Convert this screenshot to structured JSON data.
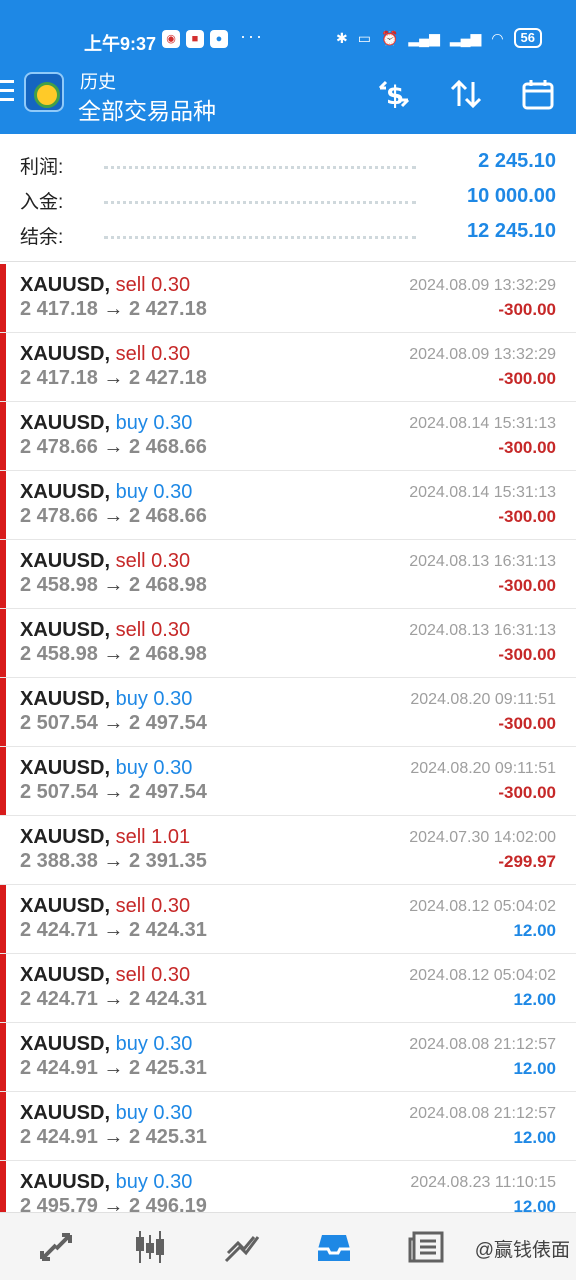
{
  "status_bar": {
    "time": "上午9:37",
    "dots": "···",
    "battery": "56",
    "icons": [
      "app-icon-1",
      "app-icon-2",
      "app-icon-3",
      "bluetooth-icon",
      "vibrate-icon",
      "alarm-icon",
      "signal-icon",
      "signal-icon",
      "wifi-icon"
    ]
  },
  "app_bar": {
    "title": "历史",
    "subtitle": "全部交易品种"
  },
  "summary": {
    "profit_label": "利润:",
    "profit_value": "2 245.10",
    "deposit_label": "入金:",
    "deposit_value": "10 000.00",
    "balance_label": "结余:",
    "balance_value": "12 245.10"
  },
  "deals": [
    {
      "symbol": "XAUUSD,",
      "side": "sell",
      "volume": "0.30",
      "open": "2 417.18",
      "arrow": "→",
      "close": "2 427.18",
      "time": "2024.08.09 13:32:29",
      "profit": "-300.00",
      "bar": true
    },
    {
      "symbol": "XAUUSD,",
      "side": "sell",
      "volume": "0.30",
      "open": "2 417.18",
      "arrow": "→",
      "close": "2 427.18",
      "time": "2024.08.09 13:32:29",
      "profit": "-300.00",
      "bar": true
    },
    {
      "symbol": "XAUUSD,",
      "side": "buy",
      "volume": "0.30",
      "open": "2 478.66",
      "arrow": "→",
      "close": "2 468.66",
      "time": "2024.08.14 15:31:13",
      "profit": "-300.00",
      "bar": true
    },
    {
      "symbol": "XAUUSD,",
      "side": "buy",
      "volume": "0.30",
      "open": "2 478.66",
      "arrow": "→",
      "close": "2 468.66",
      "time": "2024.08.14 15:31:13",
      "profit": "-300.00",
      "bar": true
    },
    {
      "symbol": "XAUUSD,",
      "side": "sell",
      "volume": "0.30",
      "open": "2 458.98",
      "arrow": "→",
      "close": "2 468.98",
      "time": "2024.08.13 16:31:13",
      "profit": "-300.00",
      "bar": true
    },
    {
      "symbol": "XAUUSD,",
      "side": "sell",
      "volume": "0.30",
      "open": "2 458.98",
      "arrow": "→",
      "close": "2 468.98",
      "time": "2024.08.13 16:31:13",
      "profit": "-300.00",
      "bar": true
    },
    {
      "symbol": "XAUUSD,",
      "side": "buy",
      "volume": "0.30",
      "open": "2 507.54",
      "arrow": "→",
      "close": "2 497.54",
      "time": "2024.08.20 09:11:51",
      "profit": "-300.00",
      "bar": true
    },
    {
      "symbol": "XAUUSD,",
      "side": "buy",
      "volume": "0.30",
      "open": "2 507.54",
      "arrow": "→",
      "close": "2 497.54",
      "time": "2024.08.20 09:11:51",
      "profit": "-300.00",
      "bar": true
    },
    {
      "symbol": "XAUUSD,",
      "side": "sell",
      "volume": "1.01",
      "open": "2 388.38",
      "arrow": "→",
      "close": "2 391.35",
      "time": "2024.07.30 14:02:00",
      "profit": "-299.97",
      "bar": false
    },
    {
      "symbol": "XAUUSD,",
      "side": "sell",
      "volume": "0.30",
      "open": "2 424.71",
      "arrow": "→",
      "close": "2 424.31",
      "time": "2024.08.12 05:04:02",
      "profit": "12.00",
      "bar": true
    },
    {
      "symbol": "XAUUSD,",
      "side": "sell",
      "volume": "0.30",
      "open": "2 424.71",
      "arrow": "→",
      "close": "2 424.31",
      "time": "2024.08.12 05:04:02",
      "profit": "12.00",
      "bar": true
    },
    {
      "symbol": "XAUUSD,",
      "side": "buy",
      "volume": "0.30",
      "open": "2 424.91",
      "arrow": "→",
      "close": "2 425.31",
      "time": "2024.08.08 21:12:57",
      "profit": "12.00",
      "bar": true
    },
    {
      "symbol": "XAUUSD,",
      "side": "buy",
      "volume": "0.30",
      "open": "2 424.91",
      "arrow": "→",
      "close": "2 425.31",
      "time": "2024.08.08 21:12:57",
      "profit": "12.00",
      "bar": true
    },
    {
      "symbol": "XAUUSD,",
      "side": "buy",
      "volume": "0.30",
      "open": "2 495.79",
      "arrow": "→",
      "close": "2 496.19",
      "time": "2024.08.23 11:10:15",
      "profit": "12.00",
      "bar": true
    }
  ],
  "bottom_nav": {
    "items": [
      "quotes-icon",
      "chart-icon",
      "trade-icon",
      "history-icon",
      "news-icon"
    ],
    "active": "history-icon",
    "watermark": "@赢钱俵面"
  },
  "colors": {
    "primary": "#1e88e5",
    "loss": "#c62828",
    "bar": "#d81b1b"
  }
}
